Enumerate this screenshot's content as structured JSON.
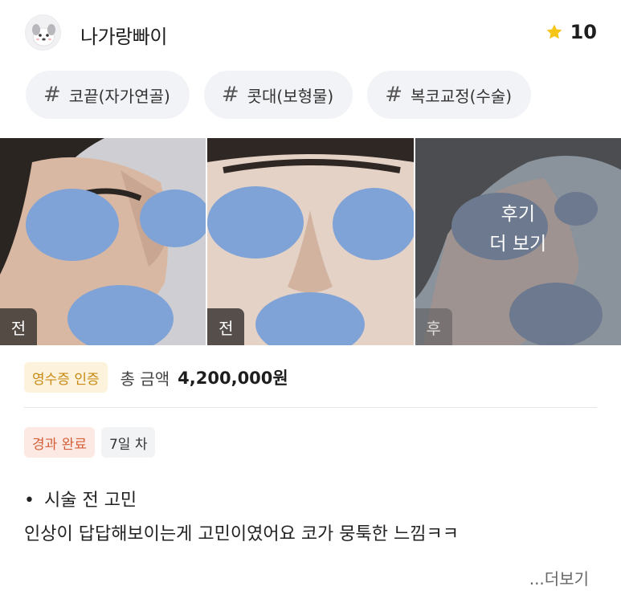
{
  "user": {
    "name": "나가랑빠이",
    "rating": "10"
  },
  "tags": [
    {
      "hash": "#",
      "label": "코끝(자가연골)"
    },
    {
      "hash": "#",
      "label": "콧대(보형물)"
    },
    {
      "hash": "#",
      "label": "복코교정(수술)"
    }
  ],
  "photos": [
    {
      "label": "전"
    },
    {
      "label": "전"
    },
    {
      "label": "후",
      "overlay_line1": "후기",
      "overlay_line2": "더 보기"
    }
  ],
  "receipt": {
    "badge": "영수증 인증",
    "total_label": "총 금액",
    "total_amount": "4,200,000원"
  },
  "progress": {
    "status_badge": "경과 완료",
    "day_badge": "7일 차"
  },
  "review": {
    "bullet": "•",
    "line1": "시술 전 고민",
    "line2": "인상이 답답해보이는게 고민이였어요 코가 뭉툭한 느낌ㅋㅋ"
  },
  "more_link": "...더보기",
  "colors": {
    "blur_blob": "#7fa3d6",
    "after_blob": "#6c7a93",
    "star": "#f5c518",
    "verify_text": "#c98a14",
    "done_text": "#d4603a"
  },
  "icons": [
    "dog-avatar-icon",
    "star-icon"
  ]
}
